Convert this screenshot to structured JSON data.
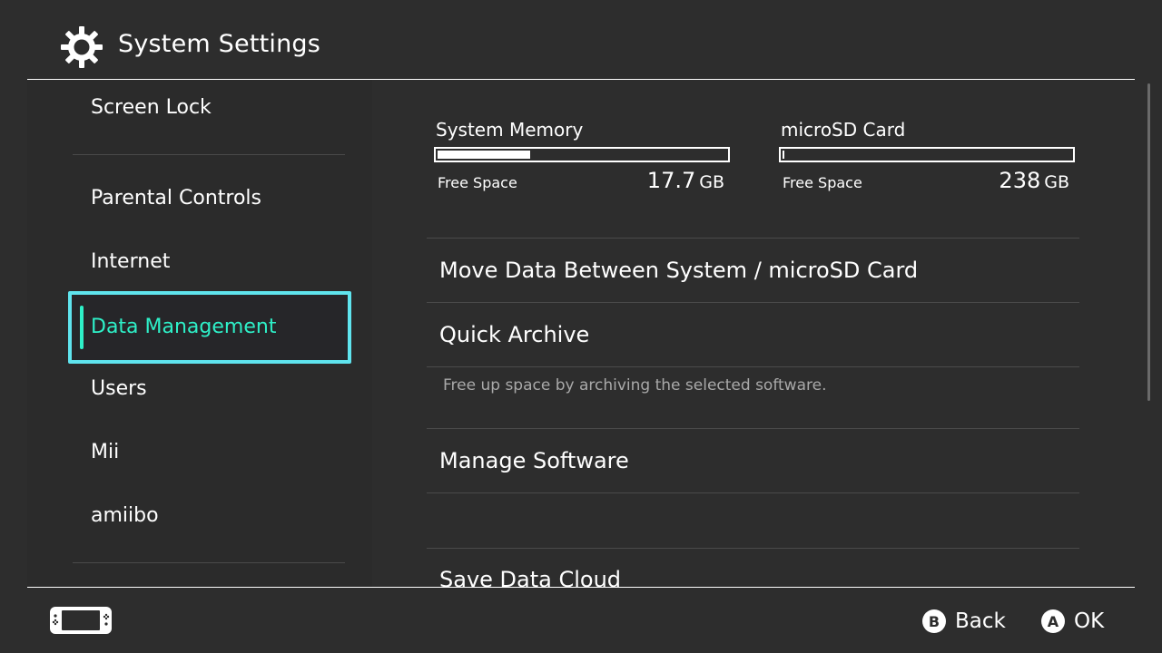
{
  "header": {
    "title": "System Settings",
    "icon": "gear-icon"
  },
  "sidebar": {
    "items": [
      {
        "label": "Screen Lock"
      },
      {
        "label": "Parental Controls"
      },
      {
        "label": "Internet"
      },
      {
        "label": "Data Management",
        "selected": true
      },
      {
        "label": "Users"
      },
      {
        "label": "Mii"
      },
      {
        "label": "amiibo"
      }
    ]
  },
  "storage": {
    "system": {
      "title": "System Memory",
      "free_label": "Free Space",
      "free_value": "17.7",
      "free_unit": "GB",
      "used_fraction": 0.32
    },
    "sd": {
      "title": "microSD Card",
      "free_label": "Free Space",
      "free_value": "238",
      "free_unit": "GB",
      "used_fraction": 0.005
    }
  },
  "menu": {
    "move_data": "Move Data Between System / microSD Card",
    "quick_archive": "Quick Archive",
    "quick_archive_desc": "Free up space by archiving the selected software.",
    "manage_software": "Manage Software",
    "save_data_cloud": "Save Data Cloud"
  },
  "footer": {
    "back_button": "B",
    "back_label": "Back",
    "ok_button": "A",
    "ok_label": "OK"
  },
  "colors": {
    "background": "#2d2d2d",
    "selection_border": "#5fe4ee",
    "selection_text": "#2ef0c8"
  }
}
